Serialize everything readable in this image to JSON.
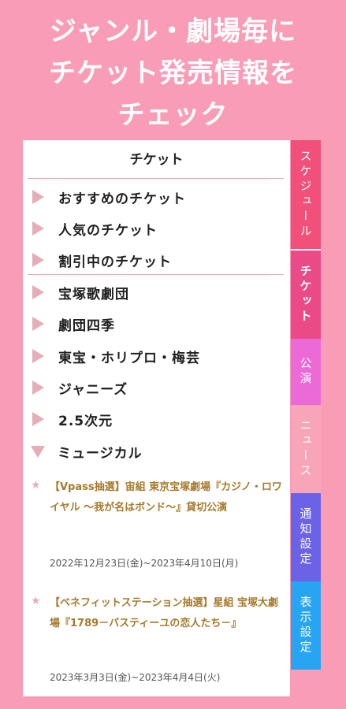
{
  "headline": {
    "line1": "ジャンル・劇場毎に",
    "line2": "チケット発売情報を",
    "line3": "チェック"
  },
  "panel": {
    "title": "チケット",
    "menu": [
      {
        "label": "おすすめのチケット",
        "expanded": false
      },
      {
        "label": "人気のチケット",
        "expanded": false
      },
      {
        "label": "割引中のチケット",
        "expanded": false
      },
      {
        "label": "宝塚歌劇団",
        "expanded": false
      },
      {
        "label": "劇団四季",
        "expanded": false
      },
      {
        "label": "東宝・ホリプロ・梅芸",
        "expanded": false
      },
      {
        "label": "ジャニーズ",
        "expanded": false
      },
      {
        "label": "2.5次元",
        "expanded": false
      },
      {
        "label": "ミュージカル",
        "expanded": true
      }
    ],
    "news": [
      {
        "star": "★",
        "title": "【Vpass抽選】宙組 東京宝塚劇場『カジノ・ロワイヤル ～我が名はボンド～』貸切公演",
        "date": "2022年12月23日(金)~2023年4月10日(月)"
      },
      {
        "star": "★",
        "title": "【ベネフィットステーション抽選】星組 宝塚大劇場『1789－バスティーユの恋人たち－』",
        "date": "2023年3月3日(金)~2023年4月4日(火)"
      }
    ]
  },
  "tabs": [
    {
      "label": "スケジュール",
      "color": "#f0507a",
      "active": false
    },
    {
      "label": "チケット",
      "color": "#ea4a86",
      "active": true
    },
    {
      "label": "公演",
      "color": "#ec6ad6",
      "active": false
    },
    {
      "label": "ニュース",
      "color": "#f9a5b9",
      "active": false
    },
    {
      "label": "通知設定",
      "color": "#6b62e6",
      "active": false
    },
    {
      "label": "表示設定",
      "color": "#27a4f2",
      "active": false
    }
  ]
}
